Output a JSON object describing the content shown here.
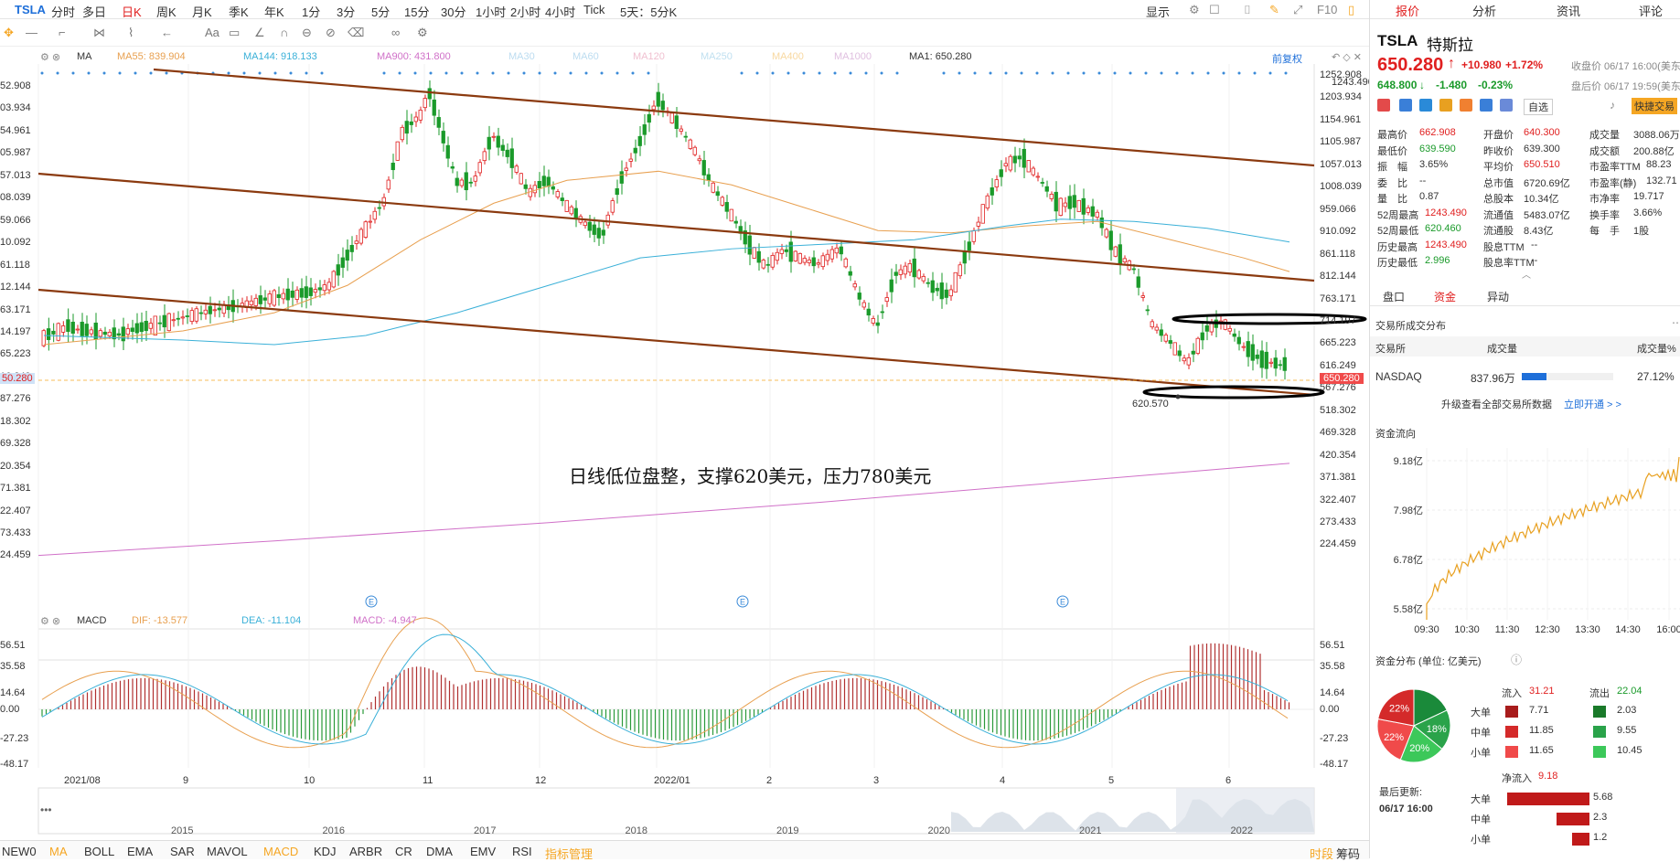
{
  "toolbar": {
    "symbol": "TSLA",
    "periods": [
      "分时",
      "多日",
      "日K",
      "周K",
      "月K",
      "季K",
      "年K",
      "1分",
      "3分",
      "5分",
      "15分",
      "30分",
      "1小时",
      "2小时",
      "4小时",
      "Tick",
      "5天：5分K"
    ],
    "active_period": "日K",
    "display_label": "显示",
    "f10_label": "F10"
  },
  "legend": {
    "ma_label": "MA",
    "ma55": "MA55: 839.904",
    "ma144": "MA144: 918.133",
    "ma900": "MA900: 431.800",
    "ma30": "MA30",
    "ma60": "MA60",
    "ma120": "MA120",
    "ma250": "MA250",
    "ma400": "MA400",
    "ma1000": "MA1000",
    "ma1": "MA1: 650.280",
    "adjust": "前复权"
  },
  "price_axis": [
    "1252.908",
    "1203.934",
    "1154.961",
    "1105.987",
    "1057.013",
    "1008.039",
    "959.066",
    "910.092",
    "861.118",
    "812.144",
    "763.171",
    "714.197",
    "665.223",
    "616.249",
    "567.276",
    "518.302",
    "469.328",
    "420.354",
    "371.381",
    "322.407",
    "273.433",
    "224.459"
  ],
  "price_axis_left": [
    "52.908",
    "03.934",
    "54.961",
    "05.987",
    "57.013",
    "08.039",
    "59.066",
    "10.092",
    "61.118",
    "12.144",
    "63.171",
    "14.197",
    "65.223",
    "16.249",
    "87.276",
    "18.302",
    "69.328",
    "20.354",
    "71.381",
    "22.407",
    "73.433",
    "24.459"
  ],
  "current_price_tag": "650.280",
  "left_price_tag": "50.280",
  "high_label": "1243.490",
  "low_label": "620.570",
  "annotation": "日线低位盘整，支撑620美元，压力780美元",
  "macd": {
    "label": "MACD",
    "dif": "DIF: -13.577",
    "dea": "DEA: -11.104",
    "macd": "MACD: -4.947",
    "axis": [
      "56.51",
      "35.58",
      "14.64",
      "0.00",
      "-27.23",
      "-48.17"
    ]
  },
  "x_axis": [
    "2021/08",
    "9",
    "10",
    "11",
    "12",
    "2022/01",
    "2",
    "3",
    "4",
    "5",
    "6"
  ],
  "year_axis": [
    "2015",
    "2016",
    "2017",
    "2018",
    "2019",
    "2020",
    "2021",
    "2022"
  ],
  "indicators": [
    "NEW0",
    "MA",
    "BOLL",
    "EMA",
    "SAR",
    "MAVOL",
    "MACD",
    "KDJ",
    "ARBR",
    "CR",
    "DMA",
    "EMV",
    "RSI",
    "指标管理"
  ],
  "indicators_right": [
    "时段",
    "筹码"
  ],
  "panel": {
    "tabs": [
      "报价",
      "分析",
      "资讯",
      "评论"
    ],
    "ticker": "TSLA",
    "name": "特斯拉",
    "price": "650.280",
    "change": "+10.980",
    "change_pct": "+1.72%",
    "close_note": "收盘价 06/17 16:00(美东",
    "ah_price": "648.800",
    "ah_change": "-1.480",
    "ah_pct": "-0.23%",
    "ah_note": "盘后价 06/17 19:59(美东",
    "self_select": "自选",
    "quick_trade": "快捷交易",
    "stats": [
      [
        "最高价",
        "662.908",
        "开盘价",
        "640.300",
        "成交量",
        "3088.06万"
      ],
      [
        "最低价",
        "639.590",
        "昨收价",
        "639.300",
        "成交额",
        "200.88亿"
      ],
      [
        "振　幅",
        "3.65%",
        "平均价",
        "650.510",
        "市盈率TTM",
        "88.23"
      ],
      [
        "委　比",
        "--",
        "总市值",
        "6720.69亿",
        "市盈率(静)",
        "132.71"
      ],
      [
        "量　比",
        "0.87",
        "总股本",
        "10.34亿",
        "市净率",
        "19.717"
      ],
      [
        "52周最高",
        "1243.490",
        "流通值",
        "5483.07亿",
        "换手率",
        "3.66%"
      ],
      [
        "52周最低",
        "620.460",
        "流通股",
        "8.43亿",
        "每　手",
        "1股"
      ],
      [
        "历史最高",
        "1243.490",
        "股息TTM",
        "--",
        "",
        ""
      ],
      [
        "历史最低",
        "2.996",
        "股息率TTM",
        "--",
        "",
        ""
      ]
    ],
    "subtabs": [
      "盘口",
      "资金",
      "异动"
    ],
    "exchange_title": "交易所成交分布",
    "exchange_headers": [
      "交易所",
      "成交量",
      "成交量%"
    ],
    "exchange_row": [
      "NASDAQ",
      "837.96万",
      "27.12%"
    ],
    "exchange_ratio": 0.2712,
    "upgrade_text": "升级查看全部交易所数据",
    "upgrade_link": "立即开通 > >",
    "fund_flow_title": "资金流向",
    "fund_axis": [
      "9.18亿",
      "7.98亿",
      "6.78亿",
      "5.58亿"
    ],
    "fund_times": [
      "09:30",
      "10:30",
      "11:30",
      "12:30",
      "13:30",
      "14:30",
      "16:00"
    ],
    "dist_title": "资金分布 (单位: 亿美元)",
    "inflow_label": "流入",
    "inflow_total": "31.21",
    "outflow_label": "流出",
    "outflow_total": "22.04",
    "rows": [
      {
        "label": "大单",
        "in": "7.71",
        "out": "2.03"
      },
      {
        "label": "中单",
        "in": "11.85",
        "out": "9.55"
      },
      {
        "label": "小单",
        "in": "11.65",
        "out": "10.45"
      }
    ],
    "pie": [
      {
        "label": "18%",
        "value": 18,
        "color": "#2aa34a"
      },
      {
        "label": "20%",
        "value": 20,
        "color": "#3cc85a"
      },
      {
        "label": "22%",
        "value": 22,
        "color": "#f04a4a"
      },
      {
        "label": "22%",
        "value": 22,
        "color": "#d42a2a"
      },
      {
        "label": "",
        "value": 18,
        "color": "#1a8a3a"
      }
    ],
    "last_update_label": "最后更新:",
    "last_update": "06/17 16:00",
    "net_label": "净流入",
    "net_total": "9.18",
    "net_rows": [
      {
        "label": "大单",
        "value": "5.68",
        "v": 5.68
      },
      {
        "label": "中单",
        "value": "2.3",
        "v": 2.3
      },
      {
        "label": "小单",
        "value": "1.2",
        "v": 1.2
      }
    ]
  },
  "colors": {
    "up": "#e02020",
    "down": "#1a9a2a",
    "channel": "#8b3a0f",
    "ma55": "#e8a050",
    "ma144": "#3ab0d8",
    "ma900": "#d070c8"
  }
}
